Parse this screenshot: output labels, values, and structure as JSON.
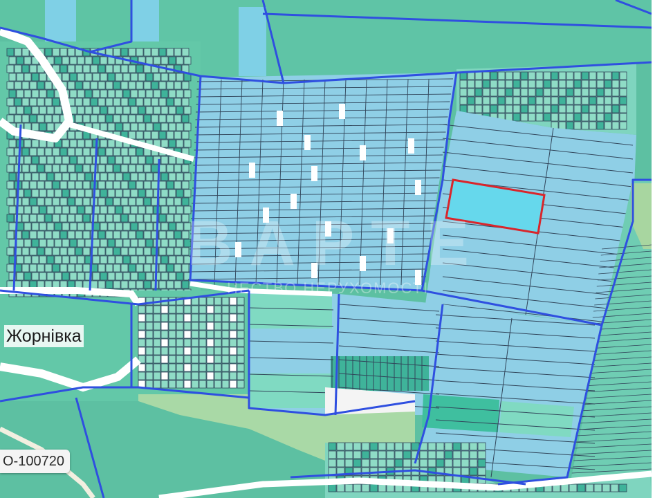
{
  "map": {
    "place_label": "Жорнівка",
    "road_label": "О-100720",
    "watermark_title": "BAPTE",
    "watermark_subtitle": "НЕСТВО НЕРУХОМОСТІ",
    "colors": {
      "parcel_teal": "#56c9ac",
      "parcel_light_teal": "#8fdcc6",
      "parcel_blue": "#8fcfe6",
      "field_green": "#5abf9c",
      "meadow": "#a9d9a6",
      "boundary_blue": "#2f4fe0",
      "parcel_line": "#31455a",
      "highlight_red": "#d9252b",
      "highlight_fill": "#66d8ec",
      "road_white": "#ffffff"
    },
    "highlighted_parcel": "selected-parcel"
  }
}
